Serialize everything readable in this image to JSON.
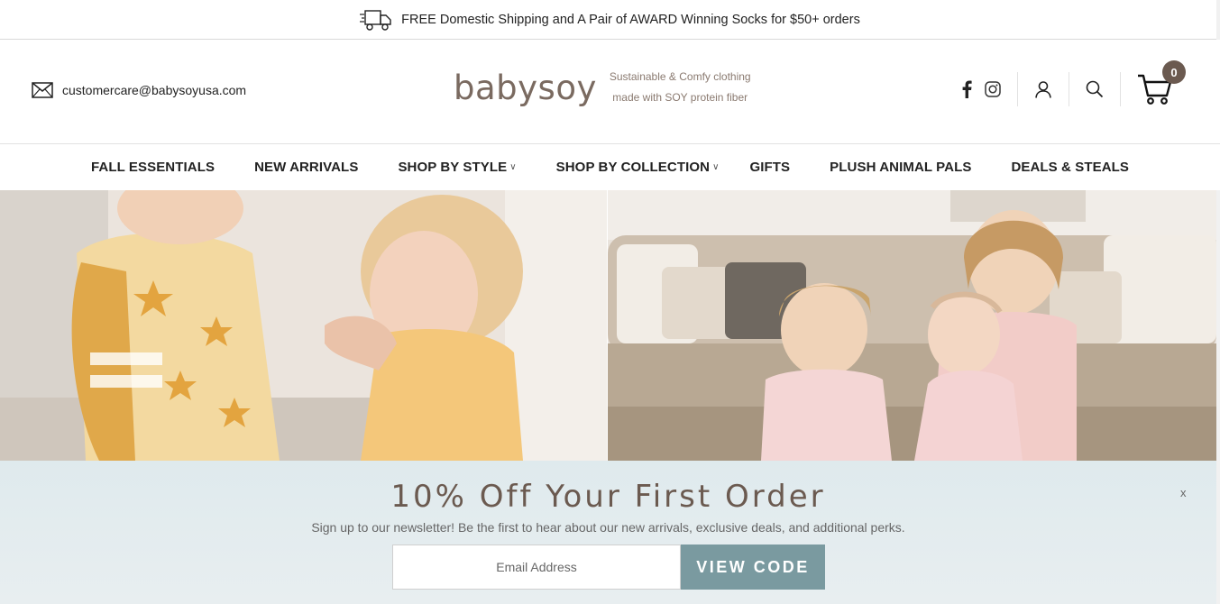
{
  "announcement": {
    "text": "FREE Domestic Shipping and A Pair of AWARD Winning Socks for $50+ orders",
    "icon": "delivery-truck-icon"
  },
  "header": {
    "email": "customercare@babysoyusa.com",
    "logo": "babysoy",
    "tagline_line1": "Sustainable & Comfy clothing",
    "tagline_line2": "made with SOY protein fiber",
    "cart_count": "0",
    "brand_color": "#6b5a50"
  },
  "nav": {
    "items": [
      {
        "label": "FALL ESSENTIALS",
        "dropdown": false
      },
      {
        "label": "NEW ARRIVALS",
        "dropdown": false
      },
      {
        "label": "SHOP BY STYLE",
        "dropdown": true
      },
      {
        "label": "SHOP BY COLLECTION",
        "dropdown": true
      },
      {
        "label": "GIFTS",
        "dropdown": false
      },
      {
        "label": "PLUSH ANIMAL PALS",
        "dropdown": false
      },
      {
        "label": "DEALS & STEALS",
        "dropdown": false
      }
    ],
    "dropdown_glyph": "∨"
  },
  "newsletter": {
    "title": "10% Off Your First Order",
    "subtitle": "Sign up to our newsletter! Be the first to hear about our new arrivals, exclusive deals, and additional perks.",
    "email_placeholder": "Email Address",
    "button_label": "VIEW CODE",
    "close_label": "x",
    "button_color": "#7a9aa0"
  }
}
